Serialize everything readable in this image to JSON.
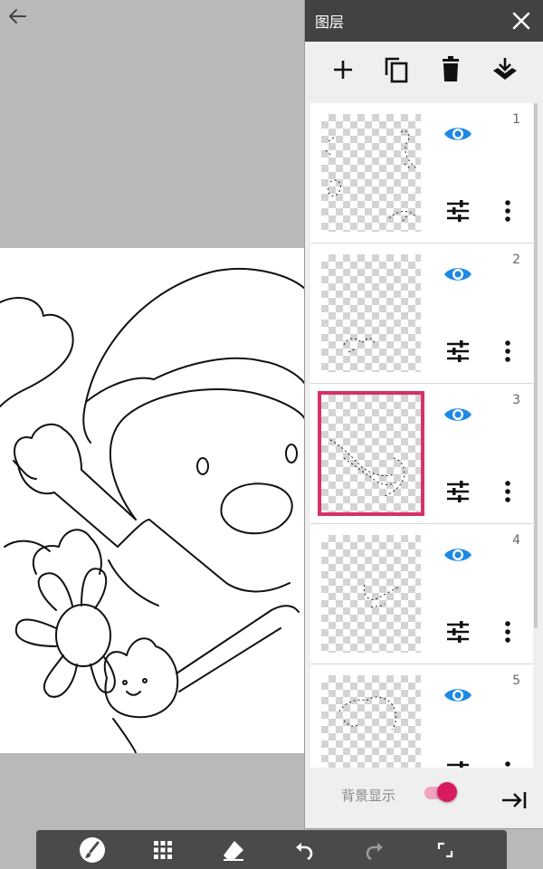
{
  "panel": {
    "title": "图层",
    "icons": {
      "close": "close-icon",
      "add": "plus-icon",
      "duplicate": "copy-icon",
      "delete": "trash-icon",
      "merge": "merge-down-icon"
    }
  },
  "layers": [
    {
      "number": "1",
      "visible": true,
      "selected": false
    },
    {
      "number": "2",
      "visible": true,
      "selected": false
    },
    {
      "number": "3",
      "visible": true,
      "selected": true
    },
    {
      "number": "4",
      "visible": true,
      "selected": false
    },
    {
      "number": "5",
      "visible": true,
      "selected": false
    }
  ],
  "footer": {
    "background_label": "背景显示",
    "background_visible": true
  },
  "bottom_toolbar": [
    "brush-icon",
    "grid-icon",
    "eraser-icon",
    "undo-icon",
    "redo-icon",
    "fullscreen-icon"
  ],
  "colors": {
    "accent": "#d81b60",
    "eye": "#1e88e5",
    "header": "#424242",
    "selection": "#d8306a"
  }
}
